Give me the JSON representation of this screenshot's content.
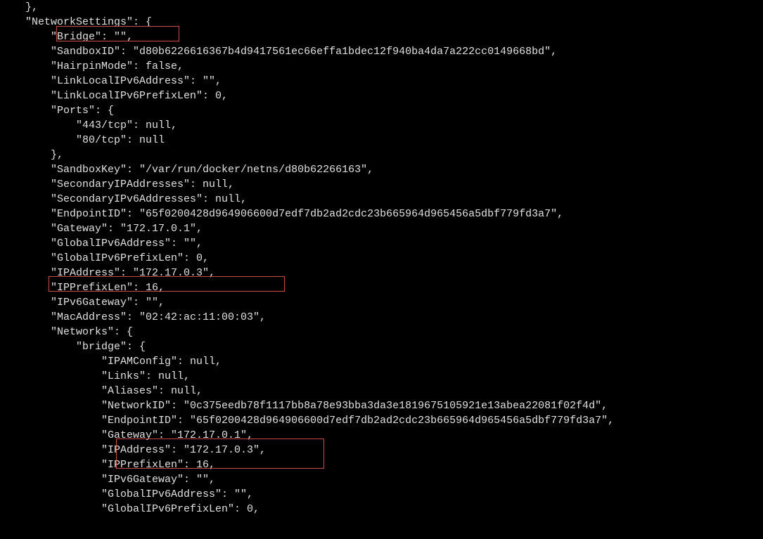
{
  "lines": [
    "    },",
    "    \"NetworkSettings\": {",
    "        \"Bridge\": \"\",",
    "        \"SandboxID\": \"d80b6226616367b4d9417561ec66effa1bdec12f940ba4da7a222cc0149668bd\",",
    "        \"HairpinMode\": false,",
    "        \"LinkLocalIPv6Address\": \"\",",
    "        \"LinkLocalIPv6PrefixLen\": 0,",
    "        \"Ports\": {",
    "            \"443/tcp\": null,",
    "            \"80/tcp\": null",
    "        },",
    "        \"SandboxKey\": \"/var/run/docker/netns/d80b62266163\",",
    "        \"SecondaryIPAddresses\": null,",
    "        \"SecondaryIPv6Addresses\": null,",
    "        \"EndpointID\": \"65f0200428d964906600d7edf7db2ad2cdc23b665964d965456a5dbf779fd3a7\",",
    "        \"Gateway\": \"172.17.0.1\",",
    "        \"GlobalIPv6Address\": \"\",",
    "        \"GlobalIPv6PrefixLen\": 0,",
    "        \"IPAddress\": \"172.17.0.3\",",
    "        \"IPPrefixLen\": 16,",
    "        \"IPv6Gateway\": \"\",",
    "        \"MacAddress\": \"02:42:ac:11:00:03\",",
    "        \"Networks\": {",
    "            \"bridge\": {",
    "                \"IPAMConfig\": null,",
    "                \"Links\": null,",
    "                \"Aliases\": null,",
    "                \"NetworkID\": \"0c375eedb78f1117bb8a78e93bba3da3e1819675105921e13abea22081f02f4d\",",
    "                \"EndpointID\": \"65f0200428d964906600d7edf7db2ad2cdc23b665964d965456a5dbf779fd3a7\",",
    "                \"Gateway\": \"172.17.0.1\",",
    "                \"IPAddress\": \"172.17.0.3\",",
    "                \"IPPrefixLen\": 16,",
    "                \"IPv6Gateway\": \"\",",
    "                \"GlobalIPv6Address\": \"\",",
    "                \"GlobalIPv6PrefixLen\": 0,"
  ],
  "highlights": {
    "bridge_label": "\"Bridge\": \"\"",
    "ipaddress_label": "\"IPAddress\": \"172.17.0.3\"",
    "gateway_ip_labels": "\"Gateway\": \"172.17.0.1\", \"IPAddress\": \"172.17.0.3\""
  }
}
